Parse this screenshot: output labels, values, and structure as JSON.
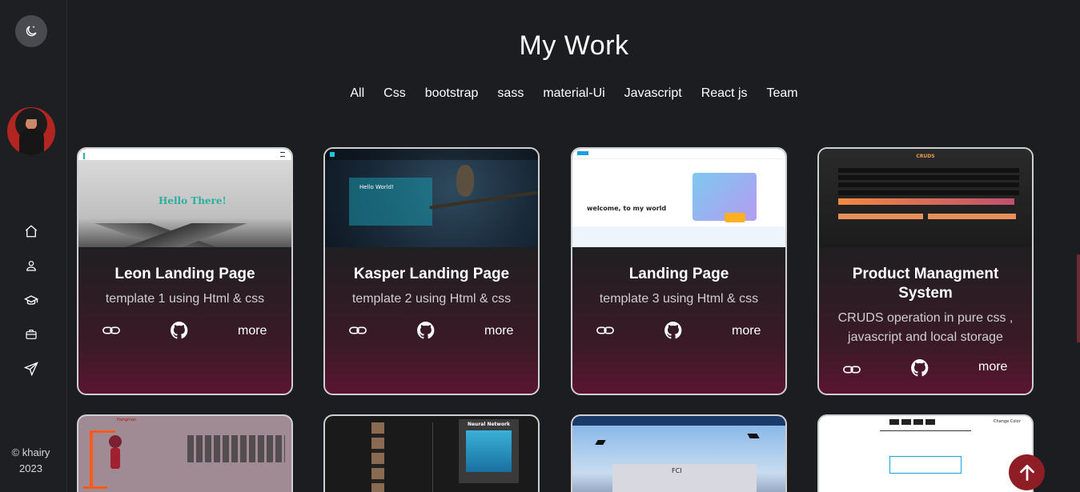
{
  "sidebar": {
    "copyright_line1": "© khairy",
    "copyright_line2": "2023",
    "nav": [
      "home-icon",
      "user-icon",
      "graduation-cap-icon",
      "briefcase-icon",
      "send-icon"
    ]
  },
  "main": {
    "title": "My Work",
    "filters": [
      "All",
      "Css",
      "bootstrap",
      "sass",
      "material-Ui",
      "Javascript",
      "React js",
      "Team"
    ]
  },
  "cards": [
    {
      "title": "Leon Landing Page",
      "desc": "template 1 using Html & css",
      "more": "more",
      "thumb_text": "Hello There!"
    },
    {
      "title": "Kasper Landing Page",
      "desc": "template 2 using Html & css",
      "more": "more",
      "thumb_text": "Hello World!"
    },
    {
      "title": "Landing Page",
      "desc": "template 3 using Html & css",
      "more": "more",
      "thumb_text": "welcome, to my world"
    },
    {
      "title": "Product Managment System",
      "desc": "CRUDS operation in pure css , javascript and local storage",
      "more": "more",
      "thumb_text": "CRUDS"
    }
  ],
  "second_row": [
    {
      "thumb_text": "Hangman"
    },
    {
      "thumb_text": "Neural Network"
    },
    {
      "thumb_text": "FCI"
    },
    {
      "thumb_text": "Change Color"
    }
  ],
  "colors": {
    "accent": "#8e1d25",
    "background": "#1c1d20"
  }
}
